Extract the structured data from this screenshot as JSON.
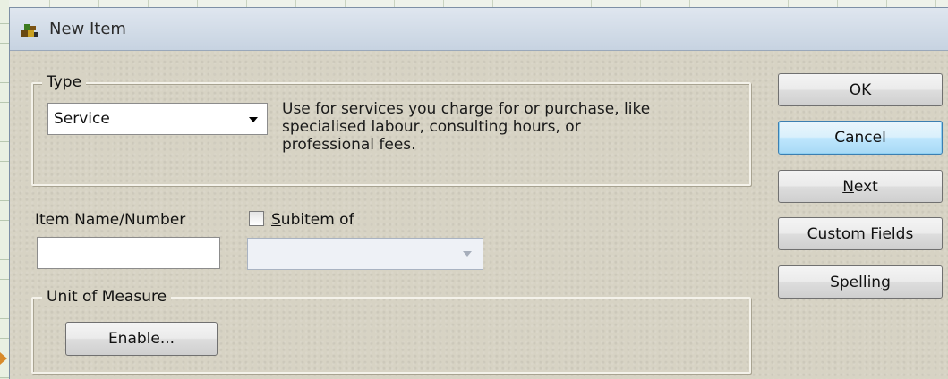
{
  "window": {
    "title": "New Item",
    "icon": "item-stack-icon"
  },
  "type_group": {
    "legend": "Type",
    "selected": "Service",
    "description_lines": [
      "Use for services you charge for or purchase, like",
      "specialised labour, consulting hours, or",
      "professional fees."
    ]
  },
  "item_name": {
    "label": "Item Name/Number",
    "value": ""
  },
  "subitem": {
    "label_prefix": "S",
    "label_rest": "ubitem of",
    "checked": false,
    "value": ""
  },
  "unit_group": {
    "legend": "Unit of Measure",
    "enable_label": "Enable..."
  },
  "buttons": {
    "ok": "OK",
    "cancel": "Cancel",
    "next_u": "N",
    "next_rest": "ext",
    "custom_fields": "Custom Fields",
    "spelling_pre": "Spellin",
    "spelling_u": "g"
  },
  "colors": {
    "dialog_bg": "#d7d3c4",
    "titlebar": "#c7d3e1",
    "default_button_border": "#3c7fb1"
  }
}
